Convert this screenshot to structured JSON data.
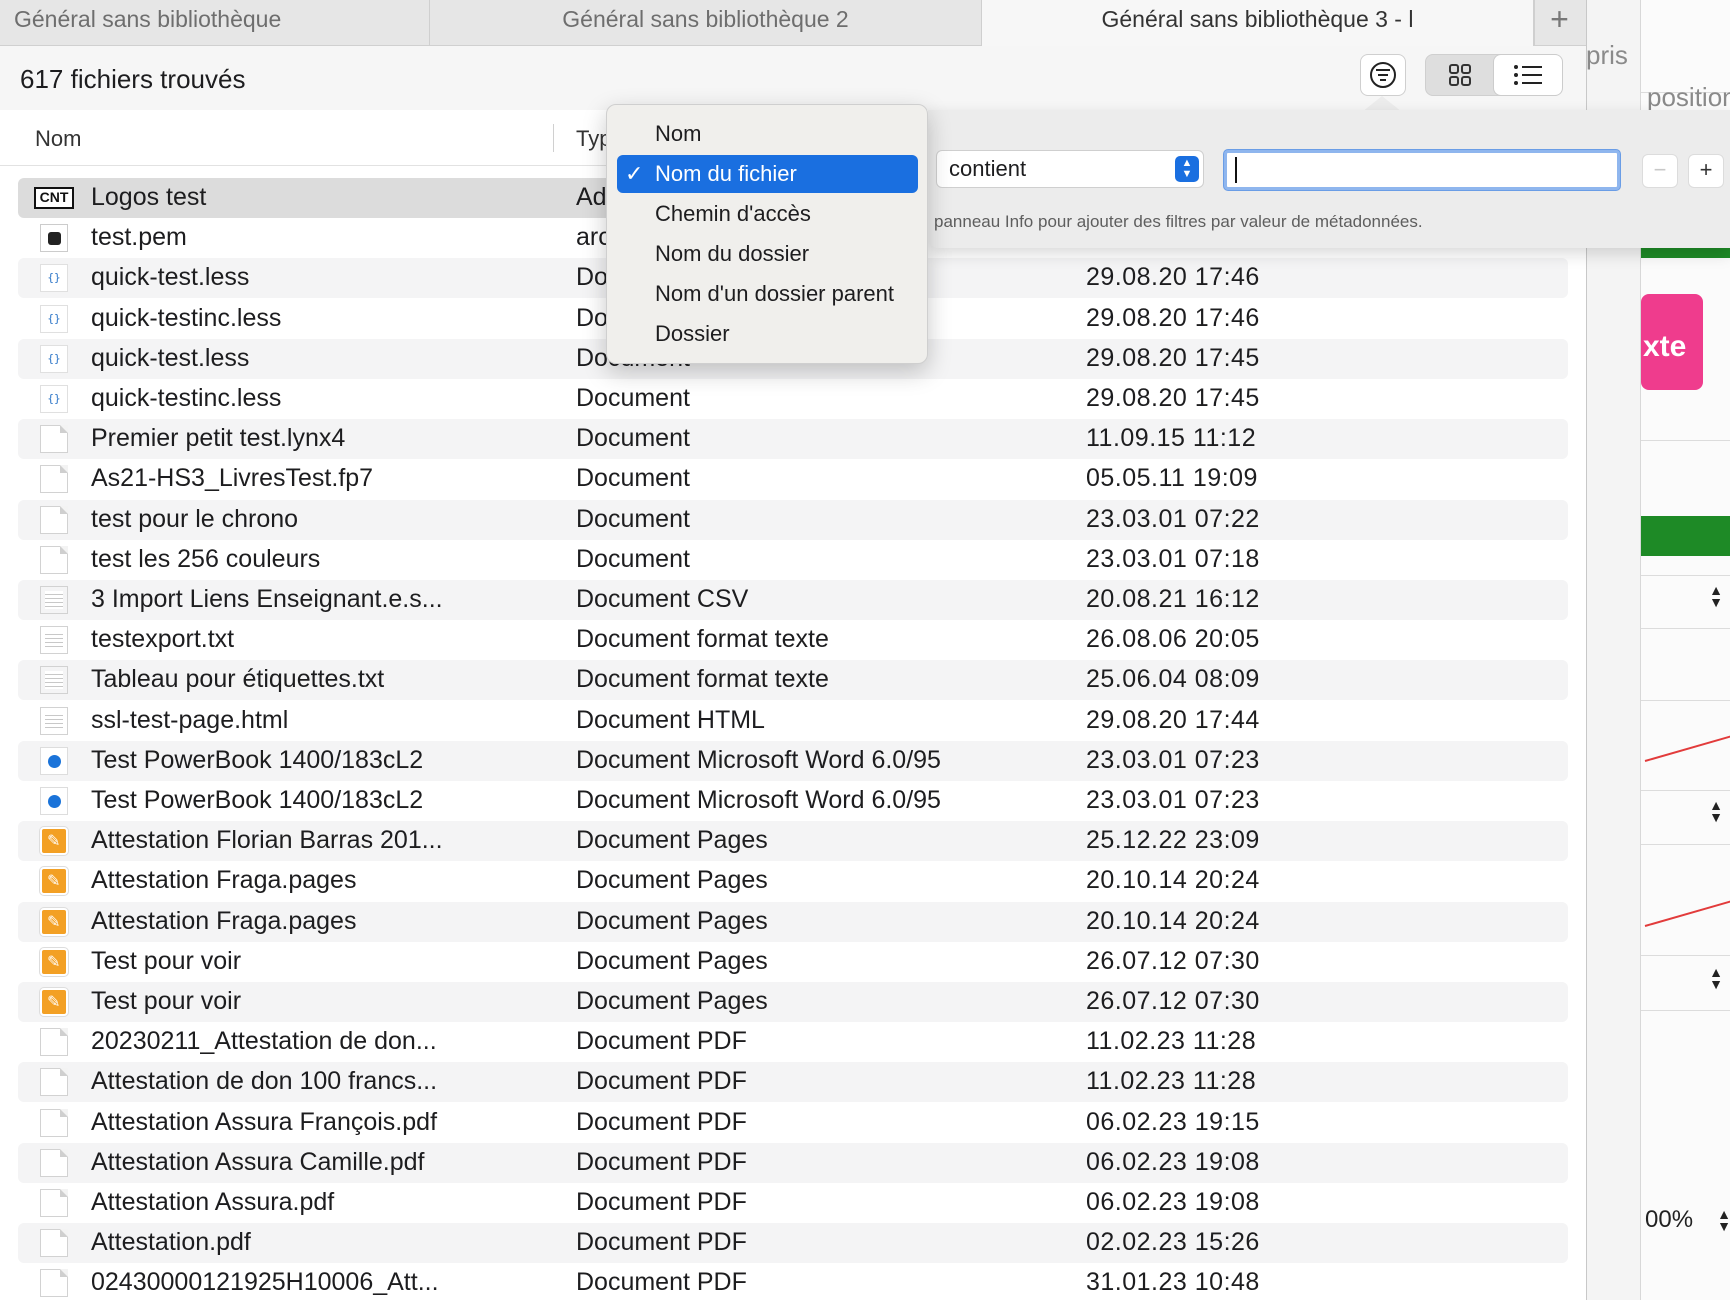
{
  "tabs": [
    {
      "label": "Général sans bibliothèque"
    },
    {
      "label": "Général sans bibliothèque 2"
    },
    {
      "label": "Général sans bibliothèque 3 - l"
    }
  ],
  "toolbar": {
    "count_label": "617 fichiers trouvés"
  },
  "columns": {
    "name": "Nom",
    "type": "Typ"
  },
  "background": {
    "text_pris": "pris",
    "text_position": "position",
    "pink_label": "xte",
    "percent": "00%"
  },
  "menu": {
    "items": [
      {
        "label": "Nom",
        "selected": false
      },
      {
        "label": "Nom du fichier",
        "selected": true
      },
      {
        "label": "Chemin d'accès",
        "selected": false
      },
      {
        "label": "Nom du dossier",
        "selected": false
      },
      {
        "label": "Nom d'un dossier parent",
        "selected": false
      },
      {
        "label": "Dossier",
        "selected": false
      }
    ],
    "check": "✓"
  },
  "filter": {
    "operator": "contient",
    "search_value": "",
    "minus": "−",
    "plus": "+",
    "hint": "panneau Info pour ajouter des filtres par valeur de métadonnées."
  },
  "files": [
    {
      "icon": "cnt-logo-icon",
      "name": "Logos test",
      "type": "Ad",
      "date": ""
    },
    {
      "icon": "pem-file-icon",
      "name": "test.pem",
      "type": "arc",
      "date": ""
    },
    {
      "icon": "less-file-icon",
      "name": "quick-test.less",
      "type": "Do",
      "date": "29.08.20 17:46"
    },
    {
      "icon": "less-file-icon",
      "name": "quick-testinc.less",
      "type": "Do",
      "date": "29.08.20 17:46"
    },
    {
      "icon": "less-file-icon",
      "name": "quick-test.less",
      "type": "Document",
      "date": "29.08.20 17:45"
    },
    {
      "icon": "less-file-icon",
      "name": "quick-testinc.less",
      "type": "Document",
      "date": "29.08.20 17:45"
    },
    {
      "icon": "blank-document-icon",
      "name": "Premier petit test.lynx4",
      "type": "Document",
      "date": "11.09.15 11:12"
    },
    {
      "icon": "blank-document-icon",
      "name": "As21-HS3_LivresTest.fp7",
      "type": "Document",
      "date": "05.05.11 19:09"
    },
    {
      "icon": "blank-document-icon",
      "name": "test pour le chrono",
      "type": "Document",
      "date": "23.03.01 07:22"
    },
    {
      "icon": "blank-document-icon",
      "name": "test les 256 couleurs",
      "type": "Document",
      "date": "23.03.01 07:18"
    },
    {
      "icon": "text-document-icon",
      "name": "3 Import Liens Enseignant.e.s...",
      "type": "Document CSV",
      "date": "20.08.21 16:12"
    },
    {
      "icon": "text-document-icon",
      "name": "testexport.txt",
      "type": "Document format texte",
      "date": "26.08.06 20:05"
    },
    {
      "icon": "text-document-icon",
      "name": "Tableau pour étiquettes.txt",
      "type": "Document format texte",
      "date": "25.06.04 08:09"
    },
    {
      "icon": "text-document-icon",
      "name": "ssl-test-page.html",
      "type": "Document HTML",
      "date": "29.08.20 17:44"
    },
    {
      "icon": "word-document-icon",
      "name": "Test PowerBook 1400/183cL2",
      "type": "Document Microsoft Word 6.0/95",
      "date": "23.03.01 07:23"
    },
    {
      "icon": "word-document-icon",
      "name": "Test PowerBook 1400/183cL2",
      "type": "Document Microsoft Word 6.0/95",
      "date": "23.03.01 07:23"
    },
    {
      "icon": "pages-document-icon",
      "name": "Attestation Florian Barras 201...",
      "type": "Document Pages",
      "date": "25.12.22 23:09"
    },
    {
      "icon": "pages-document-icon",
      "name": "Attestation Fraga.pages",
      "type": "Document Pages",
      "date": "20.10.14 20:24"
    },
    {
      "icon": "pages-document-icon",
      "name": "Attestation Fraga.pages",
      "type": "Document Pages",
      "date": "20.10.14 20:24"
    },
    {
      "icon": "pages-document-icon",
      "name": "Test pour voir",
      "type": "Document Pages",
      "date": "26.07.12 07:30"
    },
    {
      "icon": "pages-document-icon",
      "name": "Test pour voir",
      "type": "Document Pages",
      "date": "26.07.12 07:30"
    },
    {
      "icon": "blank-document-icon",
      "name": "20230211_Attestation de don...",
      "type": "Document PDF",
      "date": "11.02.23 11:28"
    },
    {
      "icon": "blank-document-icon",
      "name": "Attestation de don 100 francs...",
      "type": "Document PDF",
      "date": "11.02.23 11:28"
    },
    {
      "icon": "blank-document-icon",
      "name": "Attestation Assura François.pdf",
      "type": "Document PDF",
      "date": "06.02.23 19:15"
    },
    {
      "icon": "blank-document-icon",
      "name": "Attestation Assura Camille.pdf",
      "type": "Document PDF",
      "date": "06.02.23 19:08"
    },
    {
      "icon": "blank-document-icon",
      "name": "Attestation Assura.pdf",
      "type": "Document PDF",
      "date": "06.02.23 19:08"
    },
    {
      "icon": "blank-document-icon",
      "name": "Attestation.pdf",
      "type": "Document PDF",
      "date": "02.02.23 15:26"
    },
    {
      "icon": "blank-document-icon",
      "name": "02430000121925H10006_Att...",
      "type": "Document PDF",
      "date": "31.01.23 10:48"
    }
  ],
  "colors": {
    "accent": "#1a6fe0",
    "pages_orange": "#f3a024",
    "bg_green": "#1e8a26",
    "bg_pink": "#ef3c8d"
  }
}
